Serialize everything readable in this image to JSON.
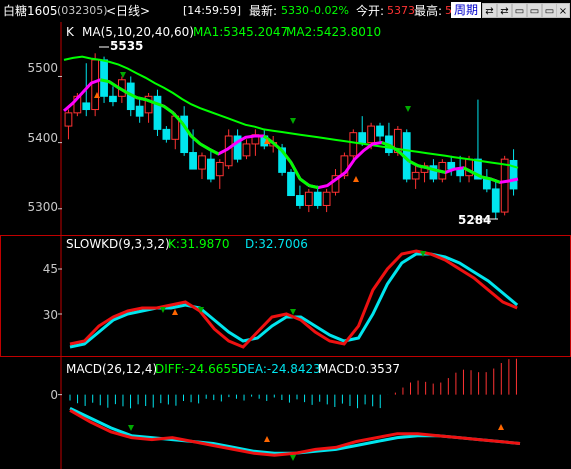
{
  "titlebar": {
    "symbol": "白糖1605",
    "code": "(032305)",
    "period": "<日线>",
    "time": "[14:59:59]",
    "latest_label": "最新:",
    "latest_value": "5330",
    "change": "-0.02%",
    "open_label": "今开:",
    "open_value": "5373",
    "high_label": "最高:",
    "high_value": "5",
    "period_button": "周期",
    "buttons": [
      "⇄",
      "⇄",
      "▭",
      "▭",
      "▭",
      "×"
    ]
  },
  "kline": {
    "label_k": "K",
    "label_ma": "MA(5,10,20,40,60)",
    "ma1": "MA1:5345.2047",
    "ma2": "MA2:5423.8010",
    "high_marker": "5535",
    "low_marker": "5284",
    "y_ticks": [
      "5500",
      "5400",
      "5300"
    ]
  },
  "kd": {
    "label": "SLOWKD(9,3,3,2)",
    "k": "K:31.9870",
    "d": "D:32.7006",
    "y_ticks": [
      "45",
      "30"
    ]
  },
  "macd": {
    "label": "MACD(26,12,4)",
    "diff": "DIFF:-24.6655",
    "dea": "DEA:-24.8423",
    "macd": "MACD:0.3537",
    "y_ticks": [
      "0"
    ]
  },
  "colors": {
    "up": "#ff3333",
    "down": "#00e5ee",
    "ma_green": "#00ff00",
    "ma_magenta": "#ff00ff",
    "panel_border": "#c00000"
  },
  "chart_data": {
    "type": "candlestick",
    "candles": [
      [
        5425,
        5450,
        5405,
        5445
      ],
      [
        5445,
        5475,
        5440,
        5470
      ],
      [
        5460,
        5520,
        5440,
        5450
      ],
      [
        5450,
        5535,
        5440,
        5525
      ],
      [
        5525,
        5530,
        5460,
        5470
      ],
      [
        5470,
        5485,
        5455,
        5462
      ],
      [
        5470,
        5500,
        5460,
        5495
      ],
      [
        5490,
        5500,
        5440,
        5450
      ],
      [
        5455,
        5465,
        5430,
        5440
      ],
      [
        5445,
        5475,
        5430,
        5470
      ],
      [
        5470,
        5480,
        5410,
        5420
      ],
      [
        5420,
        5425,
        5400,
        5405
      ],
      [
        5405,
        5445,
        5390,
        5440
      ],
      [
        5440,
        5455,
        5380,
        5385
      ],
      [
        5385,
        5420,
        5360,
        5360
      ],
      [
        5360,
        5385,
        5345,
        5380
      ],
      [
        5375,
        5390,
        5340,
        5345
      ],
      [
        5350,
        5375,
        5330,
        5370
      ],
      [
        5365,
        5420,
        5360,
        5410
      ],
      [
        5410,
        5420,
        5370,
        5375
      ],
      [
        5380,
        5405,
        5375,
        5398
      ],
      [
        5398,
        5420,
        5380,
        5412
      ],
      [
        5410,
        5420,
        5390,
        5395
      ],
      [
        5395,
        5410,
        5385,
        5400
      ],
      [
        5392,
        5398,
        5350,
        5355
      ],
      [
        5355,
        5360,
        5320,
        5320
      ],
      [
        5320,
        5335,
        5300,
        5305
      ],
      [
        5305,
        5330,
        5295,
        5325
      ],
      [
        5325,
        5335,
        5300,
        5305
      ],
      [
        5305,
        5330,
        5295,
        5325
      ],
      [
        5325,
        5360,
        5320,
        5350
      ],
      [
        5350,
        5385,
        5345,
        5380
      ],
      [
        5380,
        5420,
        5375,
        5415
      ],
      [
        5415,
        5440,
        5395,
        5400
      ],
      [
        5400,
        5430,
        5390,
        5425
      ],
      [
        5425,
        5430,
        5400,
        5410
      ],
      [
        5410,
        5430,
        5380,
        5385
      ],
      [
        5385,
        5425,
        5380,
        5420
      ],
      [
        5415,
        5420,
        5340,
        5345
      ],
      [
        5345,
        5365,
        5330,
        5355
      ],
      [
        5355,
        5370,
        5340,
        5365
      ],
      [
        5365,
        5375,
        5340,
        5345
      ],
      [
        5345,
        5375,
        5340,
        5370
      ],
      [
        5370,
        5380,
        5350,
        5360
      ],
      [
        5360,
        5380,
        5340,
        5350
      ],
      [
        5350,
        5380,
        5340,
        5375
      ],
      [
        5375,
        5465,
        5350,
        5345
      ],
      [
        5345,
        5360,
        5325,
        5330
      ],
      [
        5330,
        5345,
        5284,
        5295
      ],
      [
        5295,
        5380,
        5290,
        5375
      ],
      [
        5373,
        5390,
        5320,
        5330
      ]
    ],
    "ma_green": [
      5525,
      5528,
      5530,
      5527,
      5525,
      5522,
      5518,
      5512,
      5505,
      5498,
      5490,
      5483,
      5475,
      5466,
      5458,
      5452,
      5447,
      5442,
      5437,
      5432,
      5427,
      5424,
      5420,
      5418,
      5416,
      5414,
      5412,
      5410,
      5408,
      5406,
      5404,
      5402,
      5400,
      5398,
      5396,
      5394,
      5392,
      5390,
      5388,
      5386,
      5384,
      5382,
      5380,
      5378,
      5376,
      5374,
      5372,
      5370,
      5368,
      5366,
      5362
    ],
    "ma_short": [
      5448,
      5460,
      5475,
      5490,
      5495,
      5492,
      5483,
      5475,
      5468,
      5465,
      5460,
      5455,
      5445,
      5430,
      5410,
      5398,
      5390,
      5383,
      5390,
      5400,
      5408,
      5410,
      5410,
      5400,
      5388,
      5370,
      5345,
      5335,
      5332,
      5335,
      5345,
      5355,
      5375,
      5388,
      5398,
      5400,
      5395,
      5385,
      5372,
      5365,
      5362,
      5358,
      5355,
      5360,
      5362,
      5355,
      5348,
      5345,
      5340,
      5342,
      5345
    ],
    "kd_k": [
      20,
      21,
      26,
      29,
      31,
      32,
      32,
      33,
      34,
      31,
      25,
      21,
      19,
      24,
      29,
      30,
      28,
      24,
      21,
      20,
      26,
      38,
      45,
      50,
      51,
      50,
      48,
      45,
      42,
      38,
      34,
      32
    ],
    "kd_d": [
      19,
      20,
      24,
      28,
      30,
      31,
      32,
      32,
      33,
      32,
      28,
      24,
      21,
      22,
      26,
      29,
      29,
      26,
      23,
      21,
      22,
      30,
      40,
      47,
      50,
      50,
      49,
      47,
      44,
      41,
      37,
      33
    ],
    "macd_diff": [
      -8,
      -14,
      -19,
      -22,
      -23,
      -22,
      -24,
      -26,
      -28,
      -30,
      -31,
      -30,
      -28,
      -27,
      -24,
      -22,
      -20,
      -20,
      -21,
      -22,
      -23,
      -24,
      -25
    ],
    "macd_dea": [
      -7,
      -12,
      -17,
      -21,
      -22,
      -23,
      -24,
      -25,
      -27,
      -29,
      -30,
      -30,
      -29,
      -28,
      -26,
      -24,
      -22,
      -21,
      -21,
      -22,
      -23,
      -24,
      -25
    ]
  }
}
